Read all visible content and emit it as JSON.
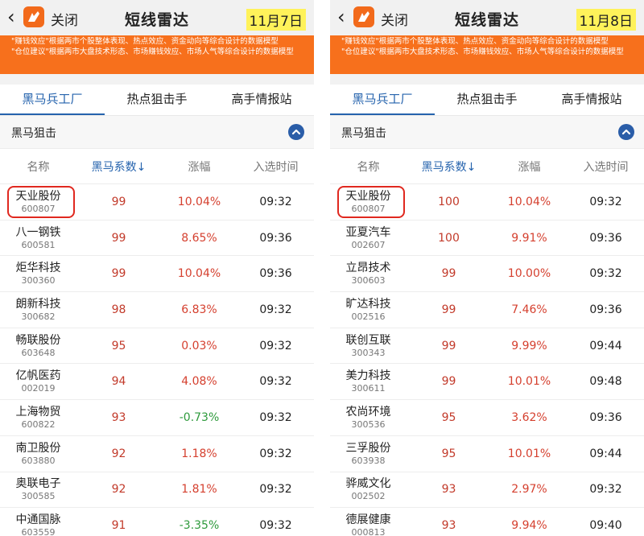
{
  "colors": {
    "accent": "#2563ad",
    "banner": "#f7701c",
    "up": "#d5402f",
    "down": "#2e9a3c"
  },
  "panels": [
    {
      "header": {
        "close_label": "关闭",
        "title": "短线雷达",
        "date": "11月7日"
      },
      "banner": {
        "line1": "\"赚钱效应\"根据两市个股整体表现、热点效应、资金动向等综合设计的数据模型",
        "line2": "\"仓位建议\"根据两市大盘技术形态、市场赚钱效应、市场人气等综合设计的数据模型"
      },
      "tabs": [
        {
          "label": "黑马兵工厂"
        },
        {
          "label": "热点狙击手"
        },
        {
          "label": "高手情报站"
        }
      ],
      "section": {
        "label": "黑马狙击"
      },
      "columns": {
        "name": "名称",
        "coef": "黑马系数↓",
        "change": "涨幅",
        "time": "入选时间"
      },
      "rows": [
        {
          "name": "天业股份",
          "code": "600807",
          "coef": "99",
          "change": "10.04%",
          "time": "09:32",
          "dir": "up",
          "highlight": true
        },
        {
          "name": "八一钢铁",
          "code": "600581",
          "coef": "99",
          "change": "8.65%",
          "time": "09:36",
          "dir": "up"
        },
        {
          "name": "炬华科技",
          "code": "300360",
          "coef": "99",
          "change": "10.04%",
          "time": "09:36",
          "dir": "up"
        },
        {
          "name": "朗新科技",
          "code": "300682",
          "coef": "98",
          "change": "6.83%",
          "time": "09:32",
          "dir": "up"
        },
        {
          "name": "畅联股份",
          "code": "603648",
          "coef": "95",
          "change": "0.03%",
          "time": "09:32",
          "dir": "up"
        },
        {
          "name": "亿帆医药",
          "code": "002019",
          "coef": "94",
          "change": "4.08%",
          "time": "09:32",
          "dir": "up"
        },
        {
          "name": "上海物贸",
          "code": "600822",
          "coef": "93",
          "change": "-0.73%",
          "time": "09:32",
          "dir": "down"
        },
        {
          "name": "南卫股份",
          "code": "603880",
          "coef": "92",
          "change": "1.18%",
          "time": "09:32",
          "dir": "up"
        },
        {
          "name": "奥联电子",
          "code": "300585",
          "coef": "92",
          "change": "1.81%",
          "time": "09:32",
          "dir": "up"
        },
        {
          "name": "中通国脉",
          "code": "603559",
          "coef": "91",
          "change": "-3.35%",
          "time": "09:32",
          "dir": "down"
        }
      ]
    },
    {
      "header": {
        "close_label": "关闭",
        "title": "短线雷达",
        "date": "11月8日"
      },
      "banner": {
        "line1": "\"赚钱效应\"根据两市个股整体表现、热点效应、资金动向等综合设计的数据模型",
        "line2": "\"仓位建议\"根据两市大盘技术形态、市场赚钱效应、市场人气等综合设计的数据模型"
      },
      "tabs": [
        {
          "label": "黑马兵工厂"
        },
        {
          "label": "热点狙击手"
        },
        {
          "label": "高手情报站"
        }
      ],
      "section": {
        "label": "黑马狙击"
      },
      "columns": {
        "name": "名称",
        "coef": "黑马系数↓",
        "change": "涨幅",
        "time": "入选时间"
      },
      "rows": [
        {
          "name": "天业股份",
          "code": "600807",
          "coef": "100",
          "change": "10.04%",
          "time": "09:32",
          "dir": "up",
          "highlight": true
        },
        {
          "name": "亚夏汽车",
          "code": "002607",
          "coef": "100",
          "change": "9.91%",
          "time": "09:36",
          "dir": "up"
        },
        {
          "name": "立昂技术",
          "code": "300603",
          "coef": "99",
          "change": "10.00%",
          "time": "09:32",
          "dir": "up"
        },
        {
          "name": "旷达科技",
          "code": "002516",
          "coef": "99",
          "change": "7.46%",
          "time": "09:36",
          "dir": "up"
        },
        {
          "name": "联创互联",
          "code": "300343",
          "coef": "99",
          "change": "9.99%",
          "time": "09:44",
          "dir": "up"
        },
        {
          "name": "美力科技",
          "code": "300611",
          "coef": "99",
          "change": "10.01%",
          "time": "09:48",
          "dir": "up"
        },
        {
          "name": "农尚环境",
          "code": "300536",
          "coef": "95",
          "change": "3.62%",
          "time": "09:36",
          "dir": "up"
        },
        {
          "name": "三孚股份",
          "code": "603938",
          "coef": "95",
          "change": "10.01%",
          "time": "09:44",
          "dir": "up"
        },
        {
          "name": "骅威文化",
          "code": "002502",
          "coef": "93",
          "change": "2.97%",
          "time": "09:32",
          "dir": "up"
        },
        {
          "name": "德展健康",
          "code": "000813",
          "coef": "93",
          "change": "9.94%",
          "time": "09:40",
          "dir": "up"
        }
      ]
    }
  ]
}
